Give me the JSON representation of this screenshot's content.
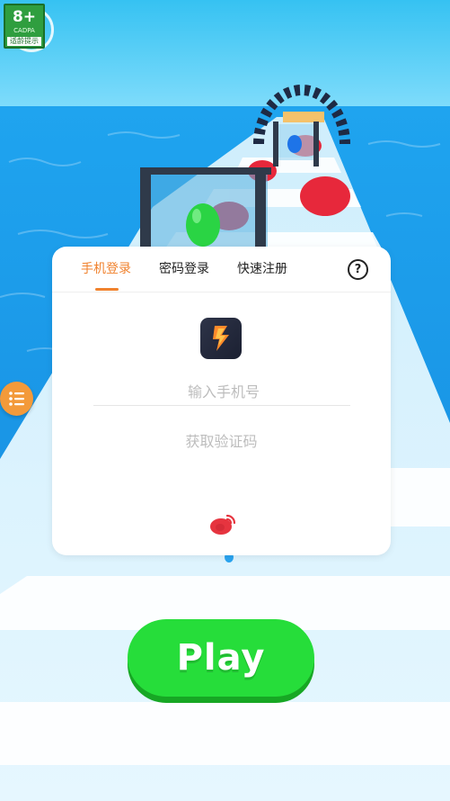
{
  "age_rating": {
    "age": "8+",
    "org": "CADPA",
    "tip": "适龄提示"
  },
  "login": {
    "tabs": [
      {
        "label": "手机登录",
        "active": true
      },
      {
        "label": "密码登录",
        "active": false
      },
      {
        "label": "快速注册",
        "active": false
      }
    ],
    "help_icon": "?",
    "phone_placeholder": "输入手机号",
    "get_code_label": "获取验证码"
  },
  "game": {
    "play_label": "Play"
  },
  "colors": {
    "accent": "#f0822e",
    "play": "#26dd3a",
    "sky": "#3fc7f4",
    "water": "#1b9be8"
  }
}
